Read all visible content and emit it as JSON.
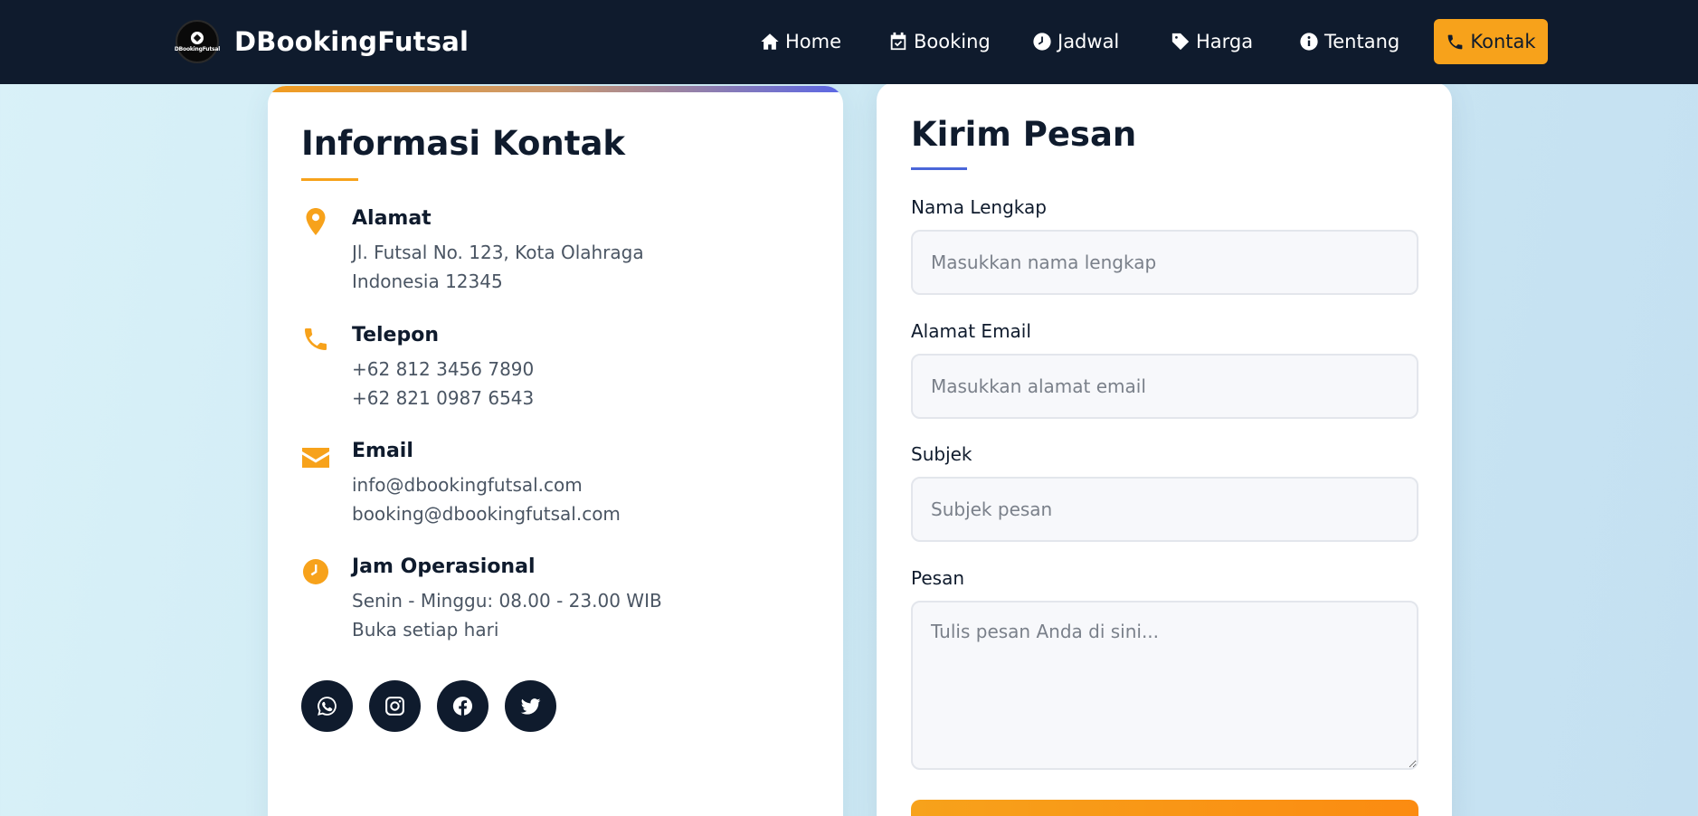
{
  "nav": {
    "brand_name": "DBookingFutsal",
    "logo_text": "DBookingFutsal",
    "links": [
      {
        "label": "Home",
        "icon": "home-icon"
      },
      {
        "label": "Booking",
        "icon": "calendar-icon"
      },
      {
        "label": "Jadwal",
        "icon": "clock-icon"
      },
      {
        "label": "Harga",
        "icon": "tag-icon"
      },
      {
        "label": "Tentang",
        "icon": "info-icon"
      }
    ],
    "cta": {
      "label": "Kontak",
      "icon": "phone-icon",
      "color": "#f7a21b"
    }
  },
  "contact_info": {
    "title": "Informasi Kontak",
    "items": [
      {
        "heading": "Alamat",
        "icon": "map-pin-icon",
        "lines": [
          "Jl. Futsal No. 123, Kota Olahraga",
          "Indonesia 12345"
        ]
      },
      {
        "heading": "Telepon",
        "icon": "phone-icon",
        "lines": [
          "+62 812 3456 7890",
          "+62 821 0987 6543"
        ]
      },
      {
        "heading": "Email",
        "icon": "envelope-icon",
        "lines": [
          "info@dbookingfutsal.com",
          "booking@dbookingfutsal.com"
        ]
      },
      {
        "heading": "Jam Operasional",
        "icon": "clock-icon",
        "lines": [
          "Senin - Minggu: 08.00 - 23.00 WIB",
          "Buka setiap hari"
        ]
      }
    ],
    "socials": [
      "whatsapp-icon",
      "instagram-icon",
      "facebook-icon",
      "twitter-icon"
    ]
  },
  "form": {
    "title": "Kirim Pesan",
    "fields": [
      {
        "label": "Nama Lengkap",
        "placeholder": "Masukkan nama lengkap",
        "value": ""
      },
      {
        "label": "Alamat Email",
        "placeholder": "Masukkan alamat email",
        "value": ""
      },
      {
        "label": "Subjek",
        "placeholder": "Subjek pesan",
        "value": ""
      },
      {
        "label": "Pesan",
        "placeholder": "Tulis pesan Anda di sini...",
        "value": ""
      }
    ]
  },
  "colors": {
    "navbar": "#0f1b2d",
    "accent": "#f7a21b",
    "form_underline": "#4a66d9"
  }
}
